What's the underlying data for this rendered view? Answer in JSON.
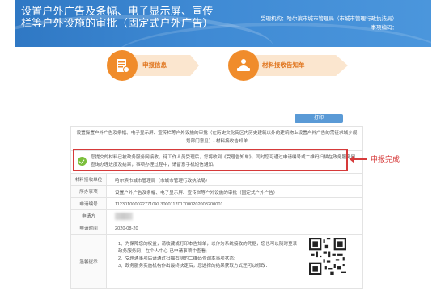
{
  "header": {
    "title": "设置户外广告及条幅、电子显示屏、宣传栏等户外设施的审批（固定式户外广告）",
    "org": "受理机构：哈尔滨市城市管理局（市城市管理行政执法局）",
    "sub": "事项编码："
  },
  "steps": [
    {
      "label": "申报信息",
      "icon": "document-icon"
    },
    {
      "label": "材料接收告知单",
      "icon": "person-desk-icon"
    }
  ],
  "print_label": "打印",
  "table": {
    "title_row": "设置操置户外广告及条幅、电子显示屏、宣传栏等户外设施的审批（在历史文化街区内历史建筑以外的建筑物上设置户外广告的需征求城乡规划部门意见）- 材料接收告知单",
    "notice": "您提交的材料已被政务服务网接收，待工作人员受理后，您将收到《受理告知单》，同时您可通过申请编号或二维码扫描在政务服务网查询办理进度及结果，事项办理过程中，请留意手机短信通知。",
    "rows": [
      {
        "label": "材料接收单位",
        "value": "哈尔滨市城市管理局（市城市管理行政执法局）"
      },
      {
        "label": "所办事项",
        "value": "设置户外广告及条幅、电子显示屏、宣传栏等户外设施的审批（固定式户外广告）"
      },
      {
        "label": "申请编号",
        "value": "1123010000227710XL3000117017000202008200001"
      },
      {
        "label": "申请方",
        "value": ""
      },
      {
        "label": "申请时间",
        "value": "2020-08-20"
      }
    ],
    "tips_label": "温馨提示",
    "tips": [
      "1、为保障您的权益，请收藏或打印本告知单，以作为系统接收的凭据，您也可以随时登录政务服务网，在个人中心-已申请事项中查看;",
      "2、受理通事项后请通过扫描右侧的二维码查询本事项状态;",
      "3、政务服务实施机构作出最终决定后，您选择的结果获取方式还可以修改："
    ]
  },
  "callout": "申报完成",
  "colors": {
    "header": "#3f8ad4",
    "accent": "#f08c2b",
    "alert": "#d63a3a",
    "check": "#7bbf3b"
  }
}
